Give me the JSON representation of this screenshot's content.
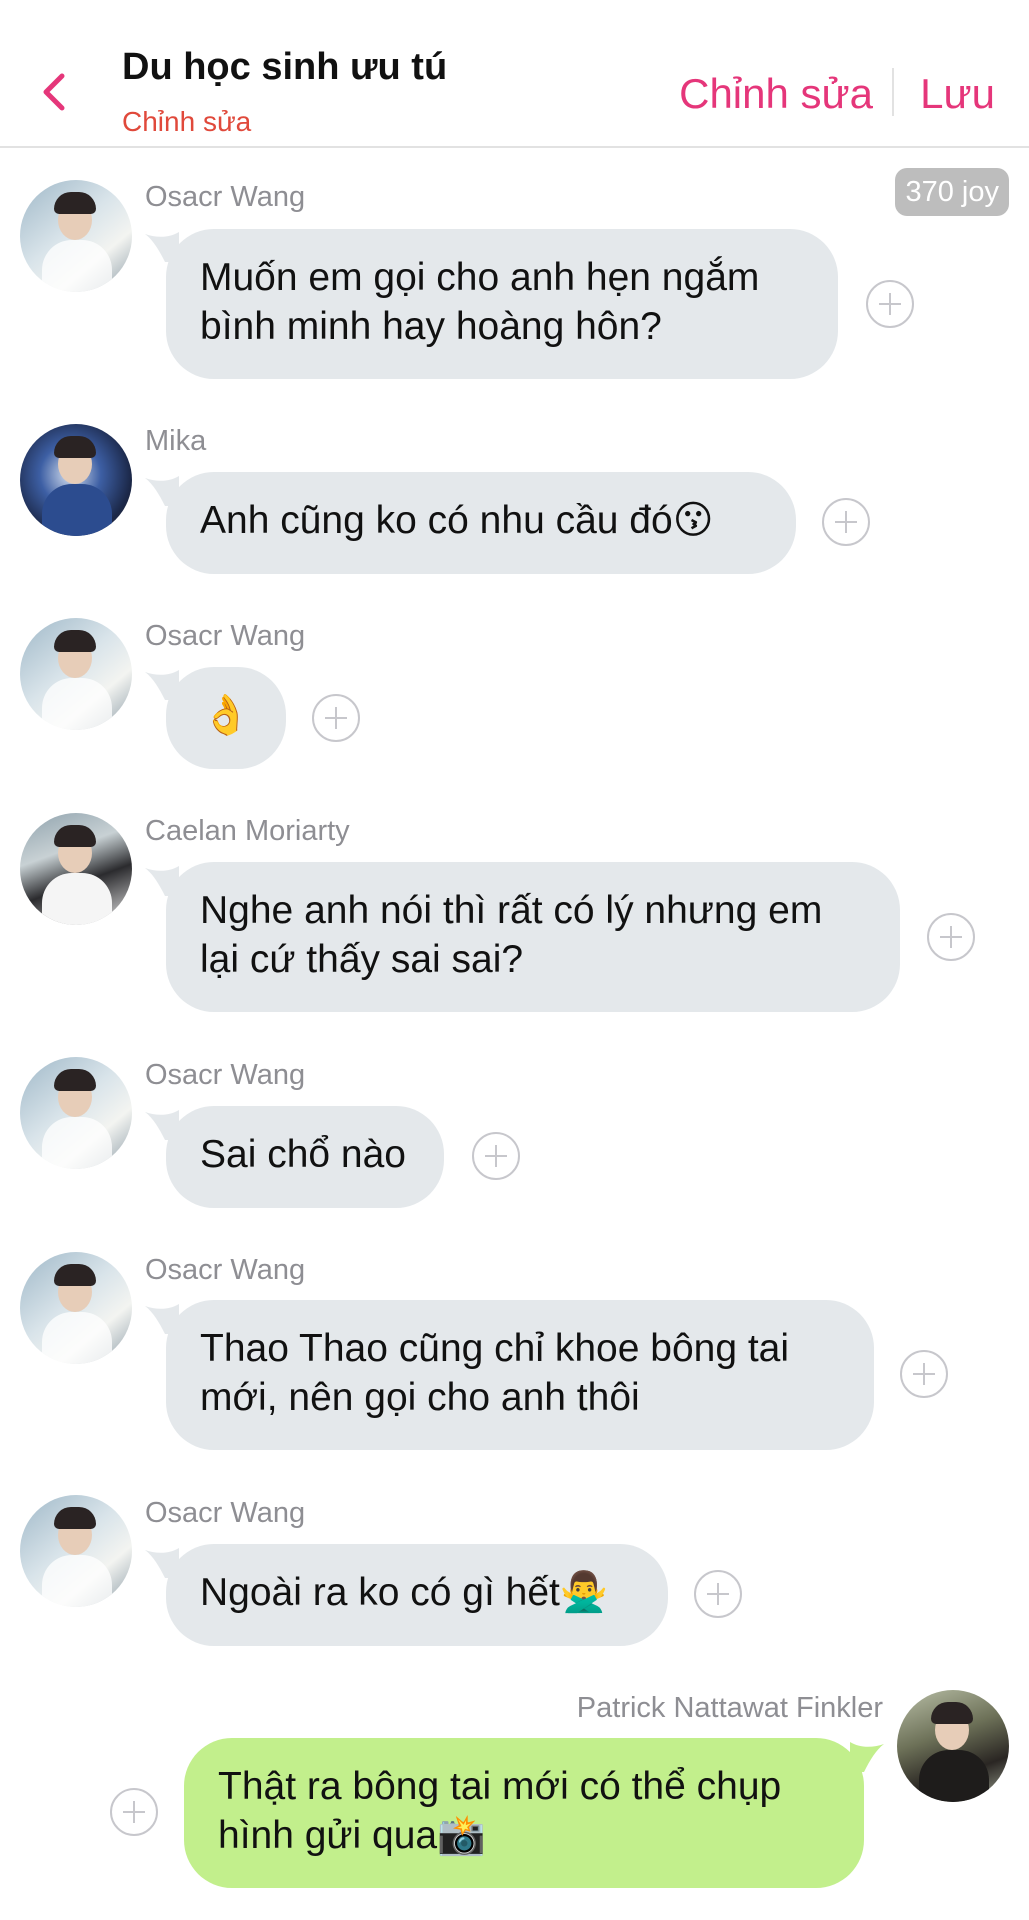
{
  "header": {
    "title": "Du học sinh ưu tú",
    "subtitle": "Chỉnh sửa",
    "edit_label": "Chỉnh sửa",
    "save_label": "Lưu"
  },
  "joy_badge": "370 joy",
  "colors": {
    "accent": "#e5367a",
    "subtitle": "#e0493b",
    "bubble_gray": "#e4e8eb",
    "bubble_green": "#c2ef8c"
  },
  "messages": [
    {
      "sender": "Osacr Wang",
      "text_line1": "Muốn em gọi cho anh hẹn ngắm",
      "text_line2": "bình minh hay hoàng hôn?"
    },
    {
      "sender": "Mika",
      "text": "Anh cũng ko có nhu cầu đó",
      "emoji": "😗"
    },
    {
      "sender": "Osacr Wang",
      "emoji": "👌"
    },
    {
      "sender": "Caelan Moriarty",
      "text_line1": "Nghe anh nói thì rất có lý nhưng em",
      "text_line2": "lại cứ thấy sai sai?"
    },
    {
      "sender": "Osacr Wang",
      "text": "Sai chổ nào"
    },
    {
      "sender": "Osacr Wang",
      "text_line1": "Thao Thao cũng chỉ khoe bông tai",
      "text_line2": "mới, nên gọi cho anh thôi"
    },
    {
      "sender": "Osacr Wang",
      "text": "Ngoài ra ko có gì hết",
      "emoji": "🙅‍♂️"
    },
    {
      "sender": "Patrick Nattawat Finkler",
      "text_line1": "Thật ra bông tai mới có thể chụp",
      "text_line2": "hình gửi qua",
      "emoji": "📸"
    }
  ]
}
